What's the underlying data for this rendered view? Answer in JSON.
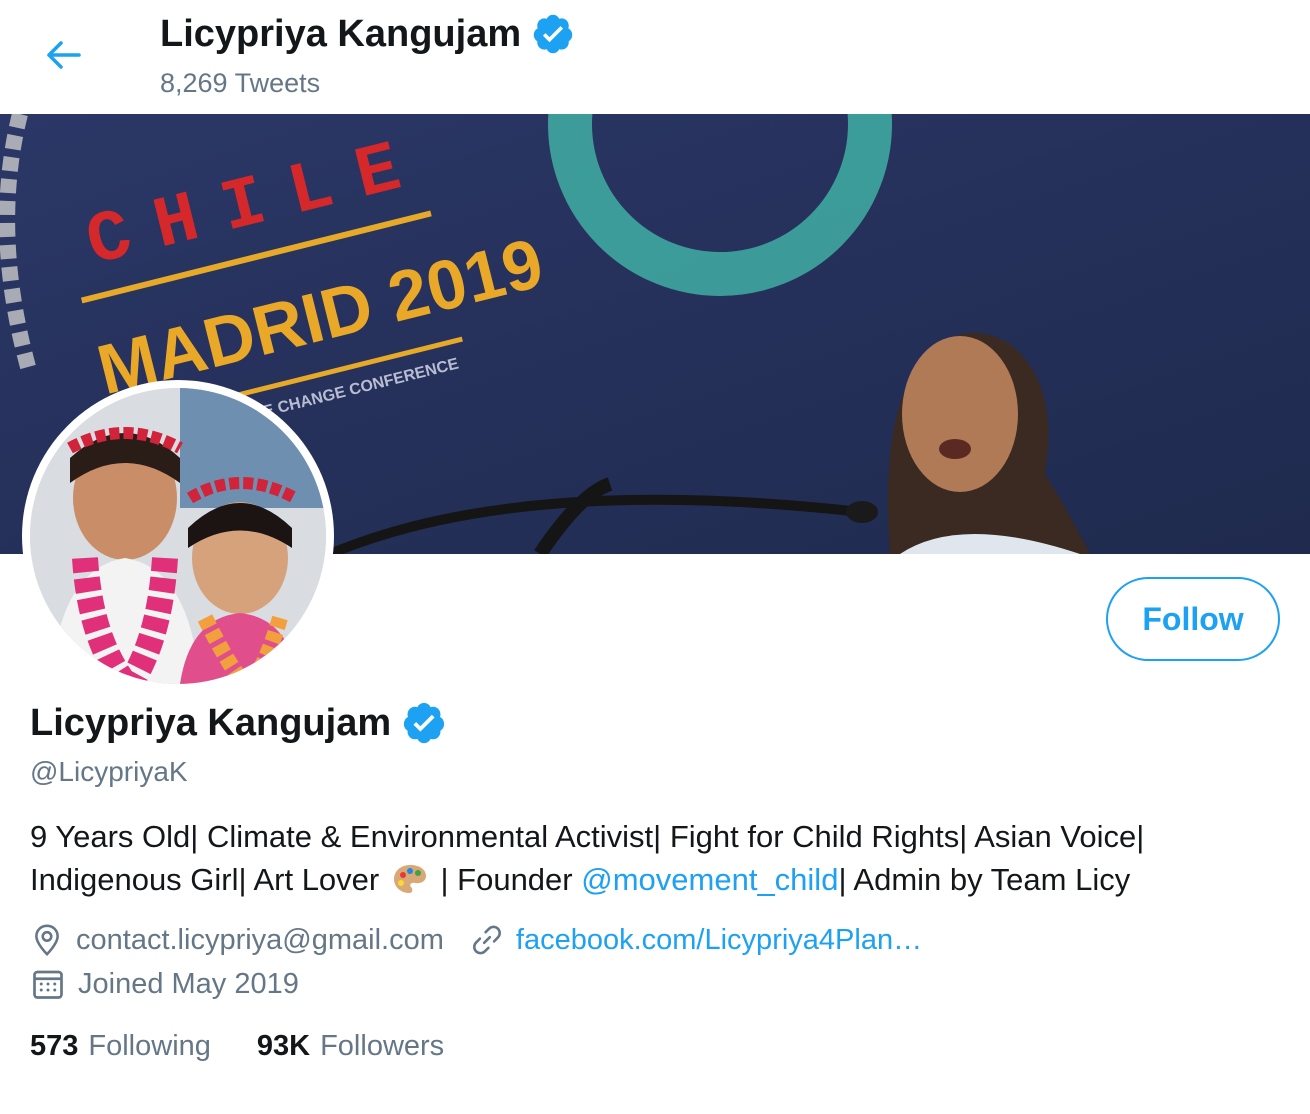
{
  "header": {
    "name": "Licypriya Kangujam",
    "tweet_count": "8,269 Tweets"
  },
  "banner": {
    "event_line1": "CHILE",
    "event_line2": "MADRID 2019",
    "event_line3": "CLIMATE CHANGE CONFERENCE"
  },
  "profile": {
    "name": "Licypriya Kangujam",
    "handle": "@LicypriyaK",
    "bio_part1": "9 Years Old| Climate & Environmental Activist| Fight for Child Rights| Asian Voice| Indigenous Girl| Art Lover",
    "bio_part2": "| Founder",
    "bio_mention": "@movement_child",
    "bio_part3": "| Admin by Team Licy",
    "location": "contact.licypriya@gmail.com",
    "website": "facebook.com/Licypriya4Plan…",
    "joined": "Joined May 2019",
    "following_count": "573",
    "following_label": "Following",
    "followers_count": "93K",
    "followers_label": "Followers"
  },
  "actions": {
    "follow_label": "Follow"
  },
  "colors": {
    "accent": "#1da1f2",
    "secondary_text": "#657786",
    "primary_text": "#14171a"
  },
  "icons": [
    "back-arrow-icon",
    "verified-badge-icon",
    "location-pin-icon",
    "link-icon",
    "calendar-icon",
    "palette-emoji-icon"
  ]
}
